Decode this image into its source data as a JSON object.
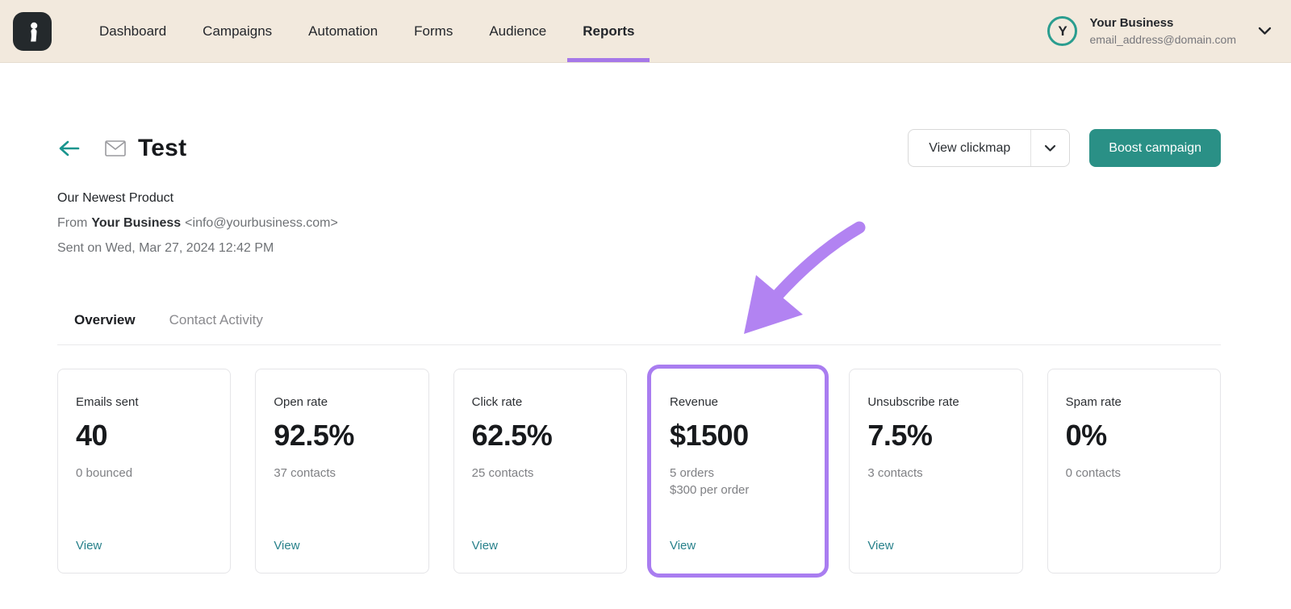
{
  "colors": {
    "nav_bg": "#f2e9dd",
    "accent_teal": "#2a9086",
    "teal_link": "#27808a",
    "highlight_purple": "#a97df0",
    "arrow_purple": "#b283f2",
    "purple_underline": "#a678e8",
    "avatar_ring": "#2a9d8f",
    "card_border": "#e5e5e8",
    "text_dark": "#1d2024",
    "text_gray": "#6f7276"
  },
  "nav": {
    "items": [
      {
        "label": "Dashboard",
        "active": false
      },
      {
        "label": "Campaigns",
        "active": false
      },
      {
        "label": "Automation",
        "active": false
      },
      {
        "label": "Forms",
        "active": false
      },
      {
        "label": "Audience",
        "active": false
      },
      {
        "label": "Reports",
        "active": true
      }
    ],
    "account": {
      "initial": "Y",
      "name": "Your Business",
      "email": "email_address@domain.com"
    }
  },
  "header": {
    "title": "Test",
    "view_clickmap_label": "View clickmap",
    "boost_label": "Boost campaign"
  },
  "campaign": {
    "subject": "Our Newest Product",
    "from_prefix": "From",
    "from_name": "Your Business",
    "from_email": "<info@yourbusiness.com>",
    "sent_line": "Sent on Wed, Mar 27, 2024 12:42 PM"
  },
  "tabs": [
    {
      "label": "Overview",
      "active": true
    },
    {
      "label": "Contact Activity",
      "active": false
    }
  ],
  "cards": [
    {
      "label": "Emails sent",
      "value": "40",
      "subtext": [
        "0 bounced"
      ],
      "view_label": "View",
      "highlighted": false
    },
    {
      "label": "Open rate",
      "value": "92.5%",
      "subtext": [
        "37 contacts"
      ],
      "view_label": "View",
      "highlighted": false
    },
    {
      "label": "Click rate",
      "value": "62.5%",
      "subtext": [
        "25 contacts"
      ],
      "view_label": "View",
      "highlighted": false
    },
    {
      "label": "Revenue",
      "value": "$1500",
      "subtext": [
        "5 orders",
        "$300 per order"
      ],
      "view_label": "View",
      "highlighted": true
    },
    {
      "label": "Unsubscribe rate",
      "value": "7.5%",
      "subtext": [
        "3 contacts"
      ],
      "view_label": "View",
      "highlighted": false
    },
    {
      "label": "Spam rate",
      "value": "0%",
      "subtext": [
        "0 contacts"
      ],
      "view_label": null,
      "highlighted": false
    }
  ]
}
